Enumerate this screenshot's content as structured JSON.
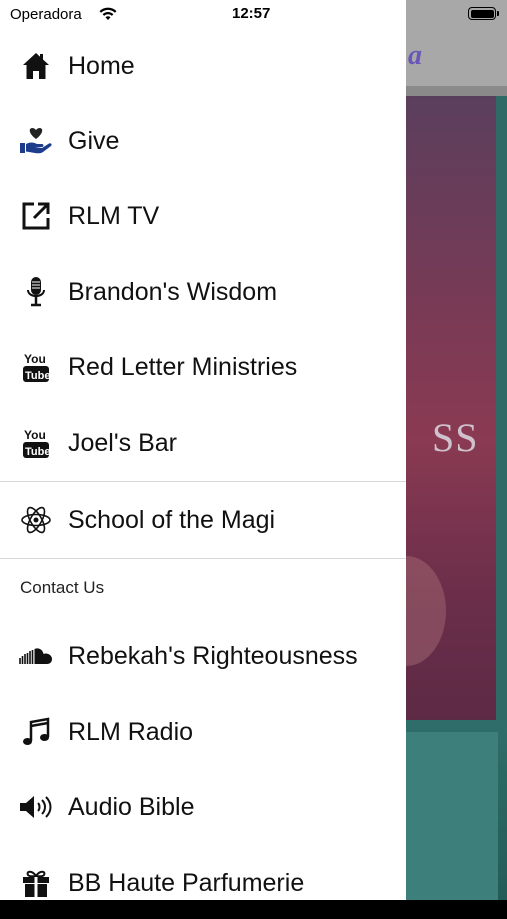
{
  "status_bar": {
    "carrier": "Operadora",
    "time": "12:57"
  },
  "background": {
    "overlay_text": "SS",
    "logo_glyph": "a"
  },
  "drawer": {
    "items": [
      {
        "label": "Home",
        "icon": "home-icon"
      },
      {
        "label": "Give",
        "icon": "hand-heart-icon"
      },
      {
        "label": "RLM TV",
        "icon": "external-link-icon"
      },
      {
        "label": "Brandon's Wisdom",
        "icon": "microphone-icon"
      },
      {
        "label": "Red Letter Ministries",
        "icon": "youtube-icon"
      },
      {
        "label": "Joel's Bar",
        "icon": "youtube-icon"
      }
    ],
    "group2": [
      {
        "label": "School of the Magi",
        "icon": "atom-icon"
      }
    ],
    "contact_section": "Contact Us",
    "contact_items": [
      {
        "label": "Rebekah's Righteousness",
        "icon": "soundcloud-icon"
      },
      {
        "label": "RLM Radio",
        "icon": "music-note-icon"
      },
      {
        "label": "Audio Bible",
        "icon": "speaker-icon"
      },
      {
        "label": "BB Haute Parfumerie",
        "icon": "gift-icon"
      }
    ]
  }
}
